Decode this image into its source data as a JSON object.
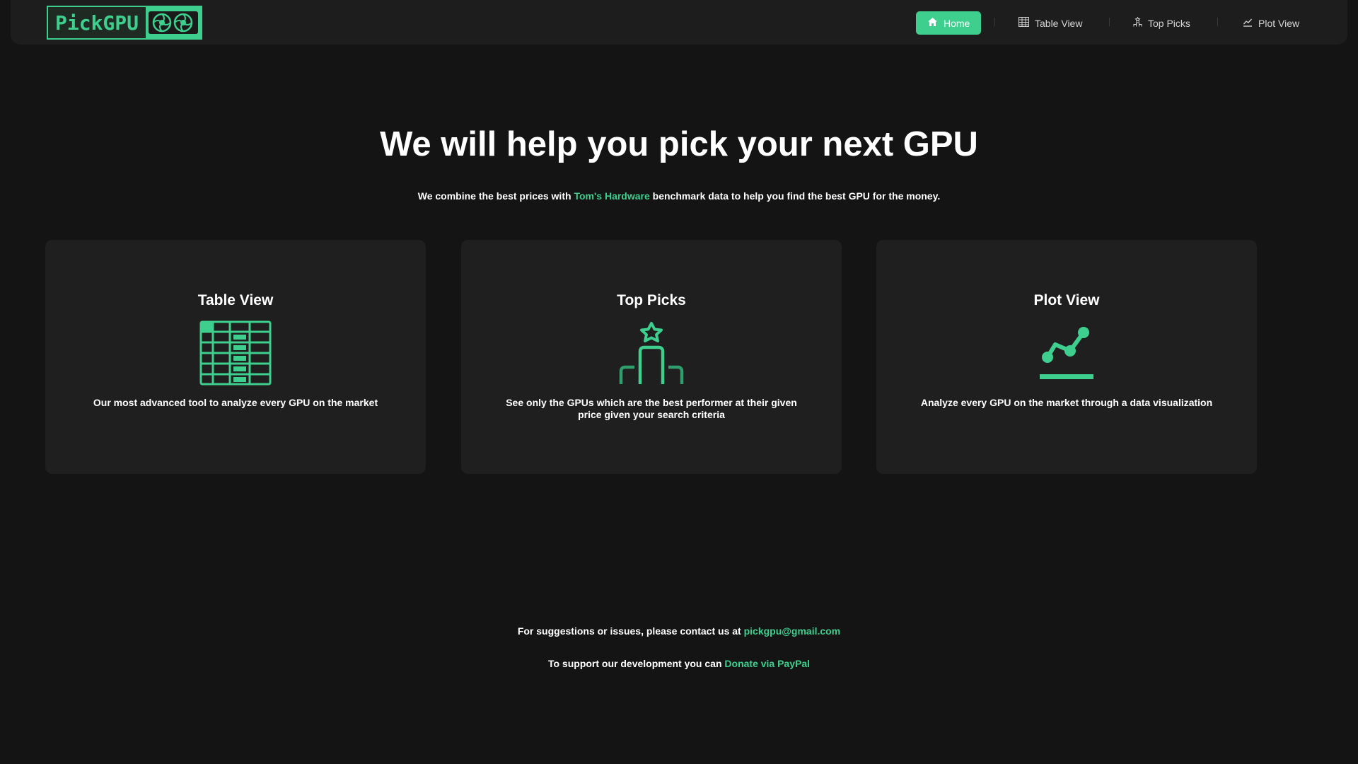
{
  "logo": {
    "text": "PickGPU",
    "icon": "gpu-card-icon"
  },
  "nav": {
    "items": [
      {
        "label": "Home",
        "icon": "home-icon",
        "active": true
      },
      {
        "label": "Table View",
        "icon": "table-icon",
        "active": false
      },
      {
        "label": "Top Picks",
        "icon": "podium-icon",
        "active": false
      },
      {
        "label": "Plot View",
        "icon": "chart-icon",
        "active": false
      }
    ]
  },
  "hero": {
    "title": "We will help you pick your next GPU",
    "subtitle_pre": "We combine the best prices with ",
    "subtitle_link": "Tom's Hardware",
    "subtitle_post": " benchmark data to help you find the best GPU for the money."
  },
  "cards": [
    {
      "title": "Table View",
      "icon": "table-icon",
      "description": "Our most advanced tool to analyze every GPU on the market"
    },
    {
      "title": "Top Picks",
      "icon": "podium-star-icon",
      "description": "See only the GPUs which are the best performer at their given price given your search criteria"
    },
    {
      "title": "Plot View",
      "icon": "line-chart-icon",
      "description": "Analyze every GPU on the market through a data visualization"
    }
  ],
  "footer": {
    "contact_pre": "For suggestions or issues, please contact us at ",
    "contact_email": "pickgpu@gmail.com",
    "donate_pre": "To support our development you can ",
    "donate_link": "Donate via PayPal"
  },
  "colors": {
    "accent": "#3ecf8e",
    "background": "#141414",
    "card": "#1f1f1f",
    "navbar": "#1d1d1d"
  }
}
